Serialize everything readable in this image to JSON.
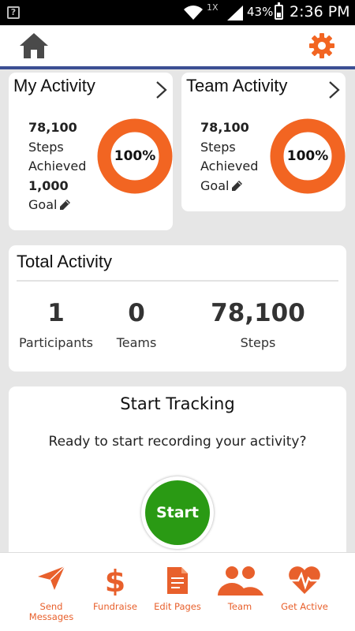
{
  "status_bar": {
    "network_type": "1X",
    "battery": "43%",
    "battery_level": 0.43,
    "time": "2:36 PM",
    "unknown_badge": "?"
  },
  "header": {
    "home_icon": "home-icon",
    "settings_icon": "gear-icon",
    "accent_color": "#f26522",
    "rule_color": "#3b4f94"
  },
  "my_activity": {
    "title": "My Activity",
    "steps_value": "78,100",
    "steps_label": "Steps",
    "achieved_label": "Achieved",
    "goal_value": "1,000",
    "goal_label": "Goal",
    "progress_label": "100%",
    "progress": 1.0
  },
  "team_activity": {
    "title": "Team Activity",
    "steps_value": "78,100",
    "steps_label": "Steps",
    "achieved_label": "Achieved",
    "goal_label": "Goal",
    "progress_label": "100%",
    "progress": 1.0
  },
  "total_activity": {
    "title": "Total Activity",
    "participants_value": "1",
    "participants_label": "Participants",
    "teams_value": "0",
    "teams_label": "Teams",
    "steps_value": "78,100",
    "steps_label": "Steps"
  },
  "tracking": {
    "title": "Start Tracking",
    "description": "Ready to start recording your activity?",
    "start_label": "Start",
    "start_color": "#2a9a14"
  },
  "bottom_nav": {
    "send_messages": "Send\nMessages",
    "fundraise": "Fundraise",
    "edit_pages": "Edit Pages",
    "team": "Team",
    "get_active": "Get Active"
  }
}
